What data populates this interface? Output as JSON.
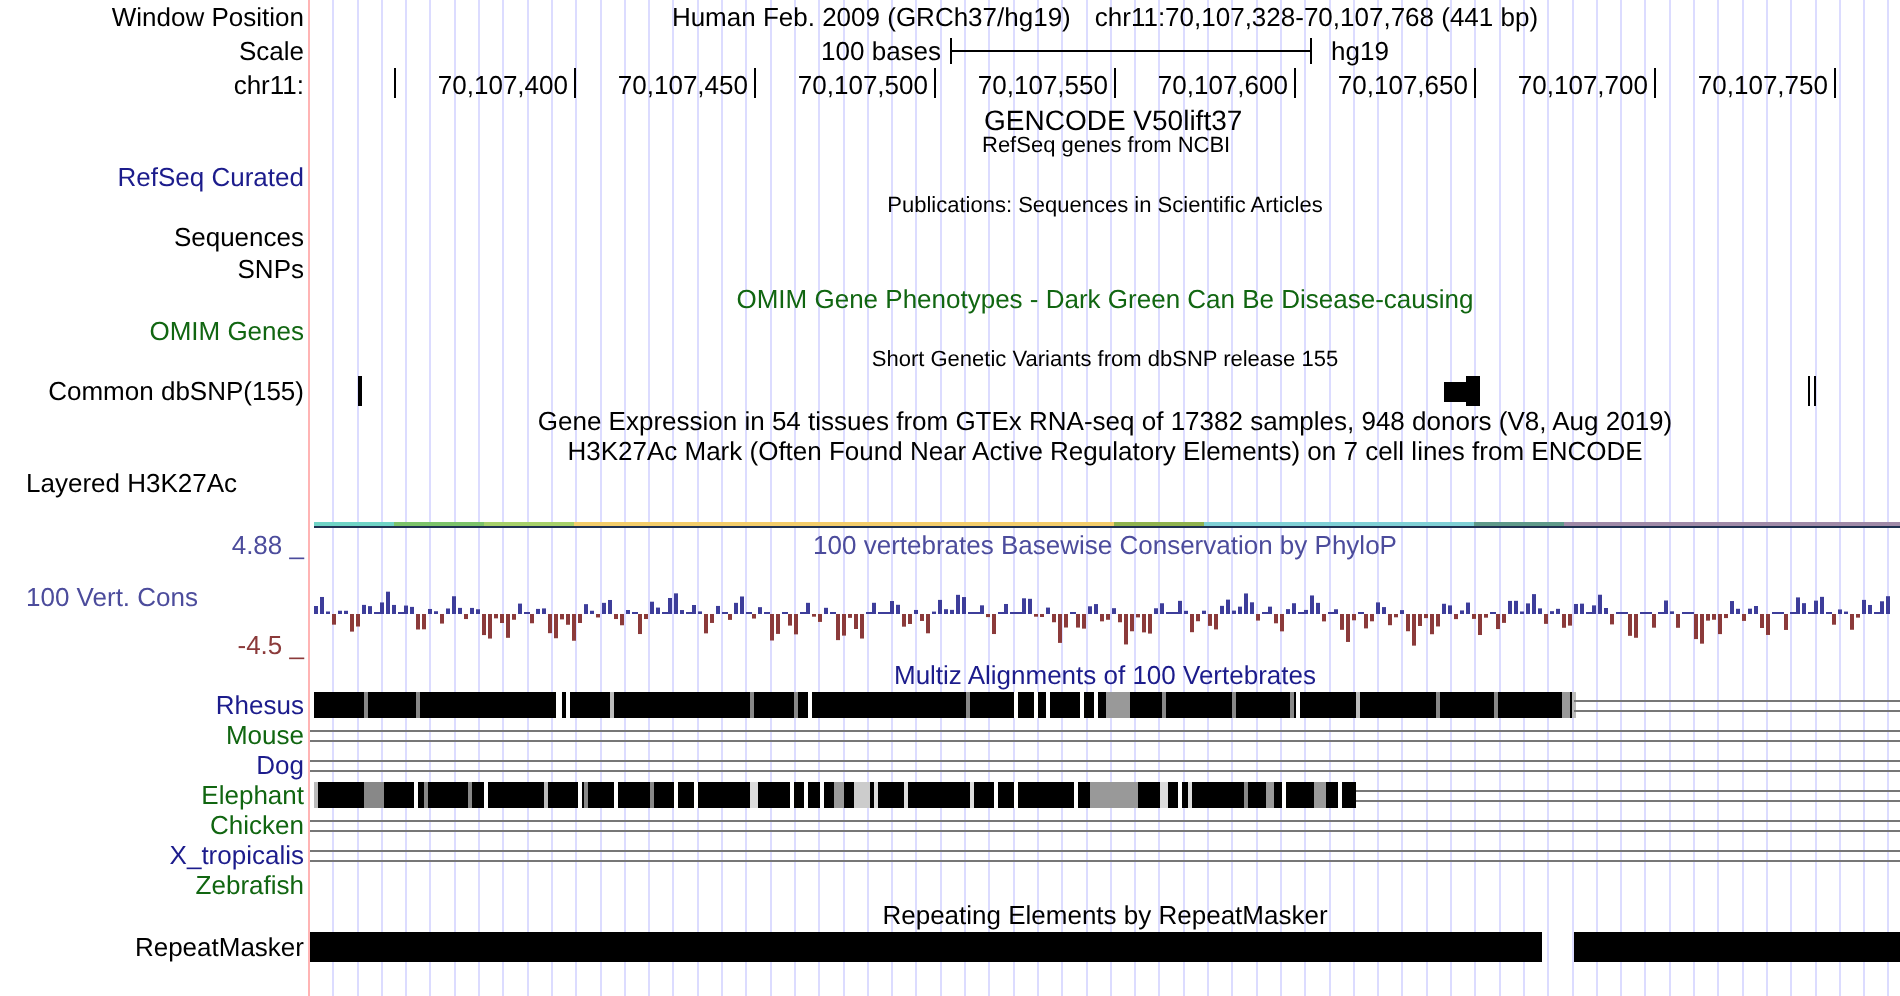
{
  "header": {
    "label": "Window Position",
    "assembly": "Human Feb. 2009 (GRCh37/hg19)",
    "position": "chr11:70,107,328-70,107,768 (441 bp)"
  },
  "scale": {
    "label": "Scale",
    "length": "100 bases",
    "assembly": "hg19"
  },
  "ruler": {
    "label": "chr11:",
    "ticks": [
      "70,107,400",
      "70,107,450",
      "70,107,500",
      "70,107,550",
      "70,107,600",
      "70,107,650",
      "70,107,700",
      "70,107,750"
    ]
  },
  "gencode": {
    "title": "GENCODE V50lift37",
    "subtitle": "RefSeq genes from NCBI"
  },
  "tracks": [
    {
      "kind": "label",
      "label": "RefSeq Curated",
      "color": "#1c1c8c"
    },
    {
      "kind": "caption",
      "caption": "Publications: Sequences in Scientific Articles"
    },
    {
      "kind": "label",
      "label": "Sequences",
      "color": "#000000"
    },
    {
      "kind": "label",
      "label": "SNPs",
      "color": "#000000"
    },
    {
      "kind": "title",
      "title": "OMIM Gene Phenotypes - Dark Green Can Be Disease-causing",
      "color": "#116611"
    },
    {
      "kind": "label",
      "label": "OMIM Genes",
      "color": "#116611"
    },
    {
      "kind": "caption",
      "caption": "Short Genetic Variants from dbSNP release 155"
    },
    {
      "kind": "variants",
      "label": "Common dbSNP(155)",
      "color": "#000000"
    },
    {
      "kind": "title",
      "title": "Gene Expression in 54 tissues from GTEx RNA-seq of 17382 samples, 948 donors (V8, Aug 2019)",
      "color": "#000000"
    },
    {
      "kind": "title",
      "title": "H3K27Ac Mark (Often Found Near Active Regulatory Elements) on 7 cell lines from ENCODE",
      "color": "#000000"
    },
    {
      "kind": "left_label",
      "label": "Layered H3K27Ac"
    },
    {
      "kind": "signal"
    }
  ],
  "conservation": {
    "title": "100 vertebrates Basewise Conservation by PhyloP",
    "label": "100 Vert. Cons",
    "max": "4.88 _",
    "min": "-4.5 _"
  },
  "multiz": {
    "title": "Multiz Alignments of 100 Vertebrates",
    "species": [
      {
        "name": "Rhesus",
        "color": "#1c1c8c",
        "kind": "block"
      },
      {
        "name": "Mouse",
        "color": "#116611",
        "kind": "lines"
      },
      {
        "name": "Dog",
        "color": "#1c1c8c",
        "kind": "lines"
      },
      {
        "name": "Elephant",
        "color": "#116611",
        "kind": "block"
      },
      {
        "name": "Chicken",
        "color": "#116611",
        "kind": "lines"
      },
      {
        "name": "X_tropicalis",
        "color": "#1c1c8c",
        "kind": "lines"
      },
      {
        "name": "Zebrafish",
        "color": "#116611",
        "kind": "none"
      }
    ]
  },
  "repeatmasker": {
    "title": "Repeating Elements by RepeatMasker",
    "label": "RepeatMasker"
  }
}
